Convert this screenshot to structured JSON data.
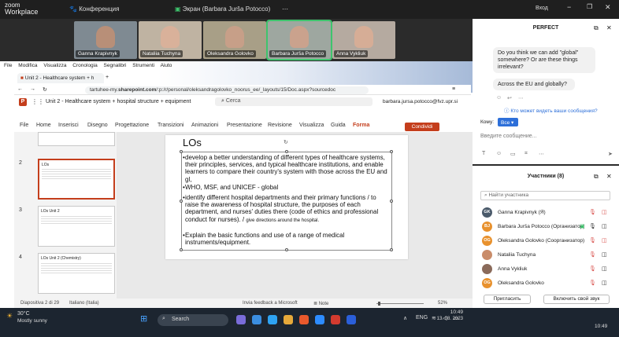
{
  "zoom": {
    "logo_line1": "zoom",
    "logo_line2": "Workplace",
    "conference_label": "Конференция",
    "screen_label": "Экран (Barbara Jurša Potocco)",
    "login_label": "Вход"
  },
  "participants_video": [
    {
      "name": "Ganna Krapivnyk"
    },
    {
      "name": "Nataliia Tuchyna"
    },
    {
      "name": "Oleksandra Golovko"
    },
    {
      "name": "Barbara Jurša Potocco"
    },
    {
      "name": "Anna Vykliuk"
    }
  ],
  "menubar": [
    "File",
    "Modifica",
    "Visualizza",
    "Cronologia",
    "Segnalibri",
    "Strumenti",
    "Aiuto"
  ],
  "browser": {
    "tab_title": "Unit 2 - Healthcare system + h",
    "address_prefix": "tartuhee-my.",
    "address_host": "sharepoint.com",
    "address_rest": "/:p:/r/personal/oleksandragolovko_noorus_ee/_layouts/15/Doc.aspx?sourcedoc"
  },
  "ppt": {
    "doc_title": "Unit 2 - Healthcare system + hospital structure + equipment",
    "search_placeholder": "Cerca",
    "user_email": "barbara.jursa.potocco@fvz.upr.si",
    "ribbon": [
      "File",
      "Home",
      "Inserisci",
      "Disegno",
      "Progettazione",
      "Transizioni",
      "Animazioni",
      "Presentazione",
      "Revisione",
      "Visualizza",
      "Guida",
      "Forma"
    ],
    "share_label": "Condividi",
    "thumbs": [
      {
        "num": "2",
        "title": "LOs"
      },
      {
        "num": "3",
        "title": "LOs Unit 2"
      },
      {
        "num": "4",
        "title": "LOs Unit 2 (Chemistry)"
      }
    ],
    "slide_title": "LOs",
    "bullets": [
      "develop a better understanding of different types of healthcare systems, their principles, services, and typical healthcare institutions, and enable learners to compare their country's system with those across the EU and gl,",
      "WHO, MSF, and UNICEF - global",
      "identify different hospital departments and their primary functions / to raise the awareness of hospital structure, the purposes of each department, and nurses' duties there (code of ethics and professional conduct for nurses). /",
      "Explain the basic functions and use of a range of medical instruments/equipment."
    ],
    "bullet3_small": "give directions around the hospital.",
    "status_slide": "Diapositiva 2 di 29",
    "status_lang": "Italiano (Italia)",
    "status_feedback": "Invia feedback a Microsoft",
    "status_notes": "Note",
    "status_zoom": "52%"
  },
  "chat": {
    "title": "PERFECT",
    "messages": [
      "Do you think we can add \"global\" somewhere? Or are these things irrelevant?",
      "Across the EU and globally?"
    ],
    "who_liked": "Кто может видеть ваши сообщения?",
    "to_label": "Кому:",
    "to_value": "Все",
    "input_placeholder": "Введите сообщение..."
  },
  "participants_panel": {
    "title": "Участники (8)",
    "search_placeholder": "Найти участника",
    "list": [
      {
        "initials": "GK",
        "name": "Ganna Krapivnyk (Я)",
        "color": "#4a5a6a"
      },
      {
        "initials": "BJ",
        "name": "Barbara Jurša Potocco (Организатор)",
        "color": "#e8912d"
      },
      {
        "initials": "OG",
        "name": "Oleksandra Golovko (Соорганизатор)",
        "color": "#e8912d"
      },
      {
        "initials": "",
        "name": "Nataliia Tuchyna",
        "color": "#c98c6a"
      },
      {
        "initials": "",
        "name": "Anna Vykliuk",
        "color": "#8a6a5a"
      },
      {
        "initials": "OG",
        "name": "Oleksandra Golovko",
        "color": "#e8912d"
      }
    ],
    "invite_label": "Пригласить",
    "unmute_label": "Включить свой звук"
  },
  "taskbar": {
    "weather_temp": "30°C",
    "weather_desc": "Mostly sunny",
    "search_label": "Search",
    "lang": "ENG",
    "time": "10:49",
    "date": "13. 08. 2023"
  },
  "colors": {
    "ppt_accent": "#c43e1c",
    "zoom_green": "#3ec46d"
  }
}
